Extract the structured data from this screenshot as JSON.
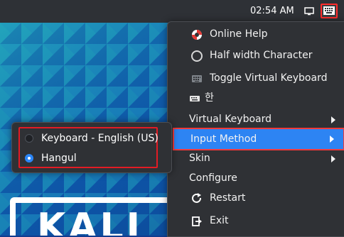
{
  "topbar": {
    "clock": "02:54 AM",
    "icons": {
      "monitor": "monitor-icon",
      "keyboard": "keyboard-icon"
    }
  },
  "menu": {
    "items": [
      {
        "label": "Online Help",
        "icon": "lifebuoy-icon"
      },
      {
        "label": "Half width Character",
        "icon": "circle-icon"
      },
      {
        "label": "Toggle Virtual Keyboard",
        "icon": "keyboard-icon"
      },
      {
        "label": "한",
        "icon": "keyboard-icon"
      },
      {
        "label": "Virtual Keyboard",
        "submenu": true
      },
      {
        "label": "Input Method",
        "submenu": true,
        "highlighted": true
      },
      {
        "label": "Skin",
        "submenu": true
      },
      {
        "label": "Configure"
      },
      {
        "label": "Restart",
        "icon": "refresh-icon"
      },
      {
        "label": "Exit",
        "icon": "logout-icon"
      }
    ]
  },
  "submenu": {
    "items": [
      {
        "label": "Keyboard - English (US)",
        "selected": false
      },
      {
        "label": "Hangul",
        "selected": true
      }
    ]
  },
  "colors": {
    "menu_bg": "#2f3135",
    "highlight": "#2d84f3",
    "focus_outline": "#f23a3a",
    "wallpaper_blue": "#0d56b8",
    "wallpaper_teal": "#1aa3a0"
  }
}
